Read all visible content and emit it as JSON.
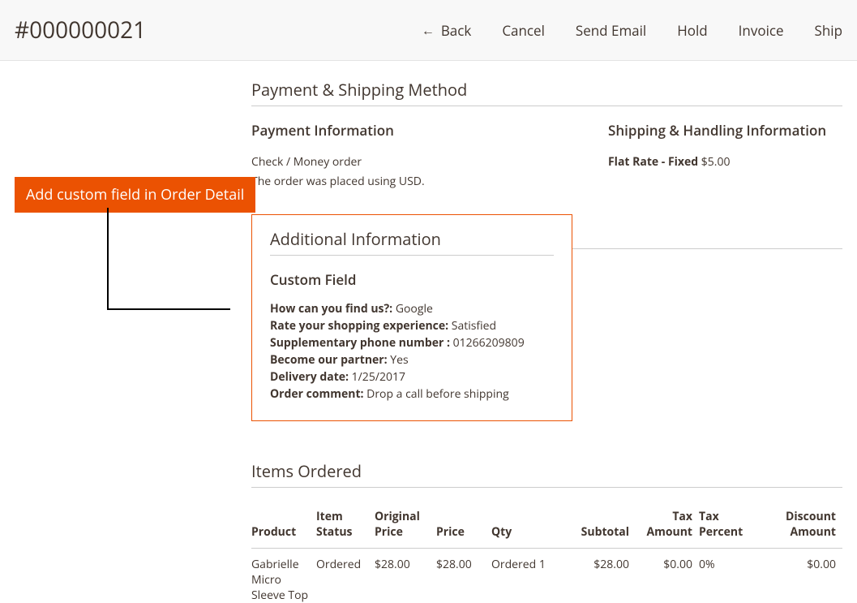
{
  "header": {
    "order_number": "#000000021",
    "actions": {
      "back": "Back",
      "cancel": "Cancel",
      "send_email": "Send Email",
      "hold": "Hold",
      "invoice": "Invoice",
      "ship": "Ship"
    }
  },
  "callout": {
    "label": "Add custom field in Order Detail"
  },
  "payment_shipping": {
    "section_title": "Payment & Shipping Method",
    "payment": {
      "title": "Payment Information",
      "method": "Check / Money order",
      "currency_note": "The order was placed using USD."
    },
    "shipping": {
      "title": "Shipping & Handling Information",
      "rate_label": "Flat Rate - Fixed",
      "rate_amount": "$5.00"
    }
  },
  "additional": {
    "section_title": "Additional Information",
    "custom_field_heading": "Custom Field",
    "fields": {
      "find_us": {
        "label": "How can you find us?:",
        "value": "Google"
      },
      "rating": {
        "label": "Rate your shopping experience:",
        "value": "Satisfied"
      },
      "phone": {
        "label": "Supplementary phone number :",
        "value": "01266209809"
      },
      "partner": {
        "label": "Become our partner:",
        "value": "Yes"
      },
      "delivery": {
        "label": "Delivery date:",
        "value": "1/25/2017"
      },
      "comment": {
        "label": "Order comment:",
        "value": "Drop a call before shipping"
      }
    }
  },
  "items": {
    "section_title": "Items Ordered",
    "columns": {
      "product": "Product",
      "status": "Item Status",
      "orig_price": "Original Price",
      "price": "Price",
      "qty": "Qty",
      "subtotal": "Subtotal",
      "tax_amount": "Tax Amount",
      "tax_percent": "Tax Percent",
      "discount": "Discount Amount"
    },
    "rows": [
      {
        "product": "Gabrielle Micro Sleeve Top",
        "status": "Ordered",
        "orig_price": "$28.00",
        "price": "$28.00",
        "qty_label": "Ordered",
        "qty_value": "1",
        "subtotal": "$28.00",
        "tax_amount": "$0.00",
        "tax_percent": "0%",
        "discount": "$0.00"
      }
    ]
  }
}
